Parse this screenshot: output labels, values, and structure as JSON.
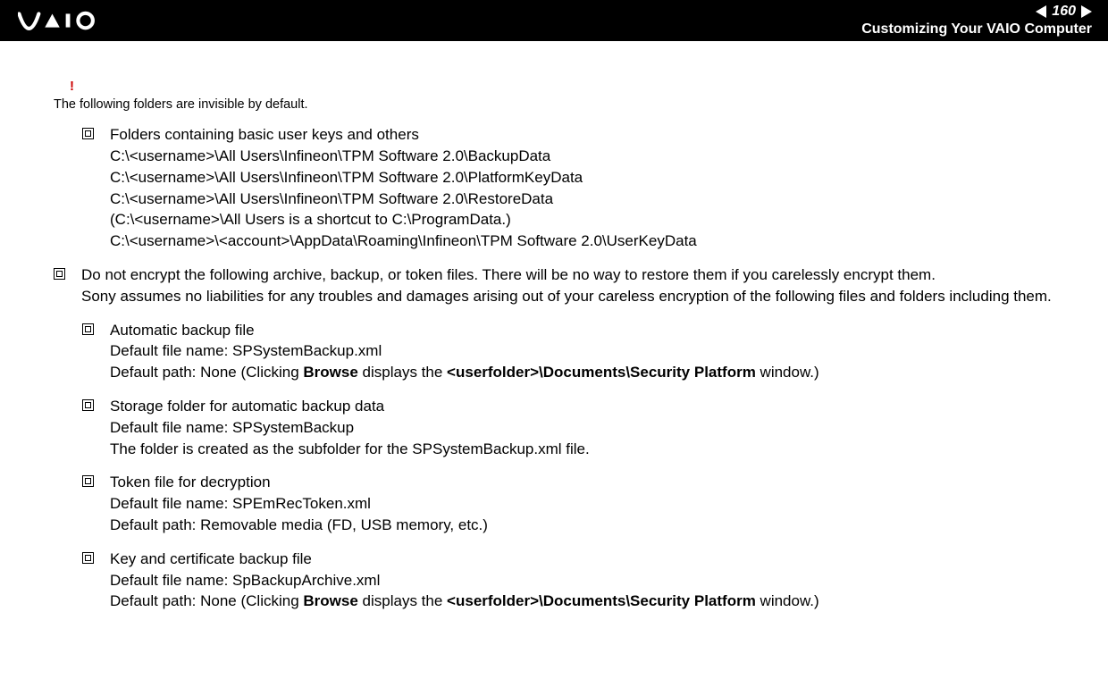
{
  "header": {
    "page_number": "160",
    "section_title": "Customizing Your VAIO Computer"
  },
  "alert": {
    "mark": "!",
    "text": "The following folders are invisible by default."
  },
  "list1": {
    "item1": {
      "title": "Folders containing basic user keys and others",
      "line1": "C:\\<username>\\All Users\\Infineon\\TPM Software 2.0\\BackupData",
      "line2": "C:\\<username>\\All Users\\Infineon\\TPM Software 2.0\\PlatformKeyData",
      "line3": "C:\\<username>\\All Users\\Infineon\\TPM Software 2.0\\RestoreData",
      "line4": "(C:\\<username>\\All Users is a shortcut to C:\\ProgramData.)",
      "line5": "C:\\<username>\\<account>\\AppData\\Roaming\\Infineon\\TPM Software 2.0\\UserKeyData"
    }
  },
  "warning": {
    "line1": "Do not encrypt the following archive, backup, or token files. There will be no way to restore them if you carelessly encrypt them.",
    "line2": "Sony assumes no liabilities for any troubles and damages arising out of your careless encryption of the following files and folders including them."
  },
  "list2": {
    "item1": {
      "title": "Automatic backup file",
      "line1": "Default file name: SPSystemBackup.xml",
      "line2_a": "Default path: None (Clicking ",
      "line2_b": "Browse",
      "line2_c": " displays the ",
      "line2_d": "<userfolder>\\Documents\\Security Platform",
      "line2_e": " window.)"
    },
    "item2": {
      "title": "Storage folder for automatic backup data",
      "line1": "Default file name: SPSystemBackup",
      "line2": "The folder is created as the subfolder for the SPSystemBackup.xml file."
    },
    "item3": {
      "title": "Token file for decryption",
      "line1": "Default file name: SPEmRecToken.xml",
      "line2": "Default path: Removable media (FD, USB memory, etc.)"
    },
    "item4": {
      "title": "Key and certificate backup file",
      "line1": "Default file name: SpBackupArchive.xml",
      "line2_a": "Default path: None (Clicking ",
      "line2_b": "Browse",
      "line2_c": " displays the ",
      "line2_d": "<userfolder>\\Documents\\Security Platform",
      "line2_e": " window.)"
    }
  }
}
